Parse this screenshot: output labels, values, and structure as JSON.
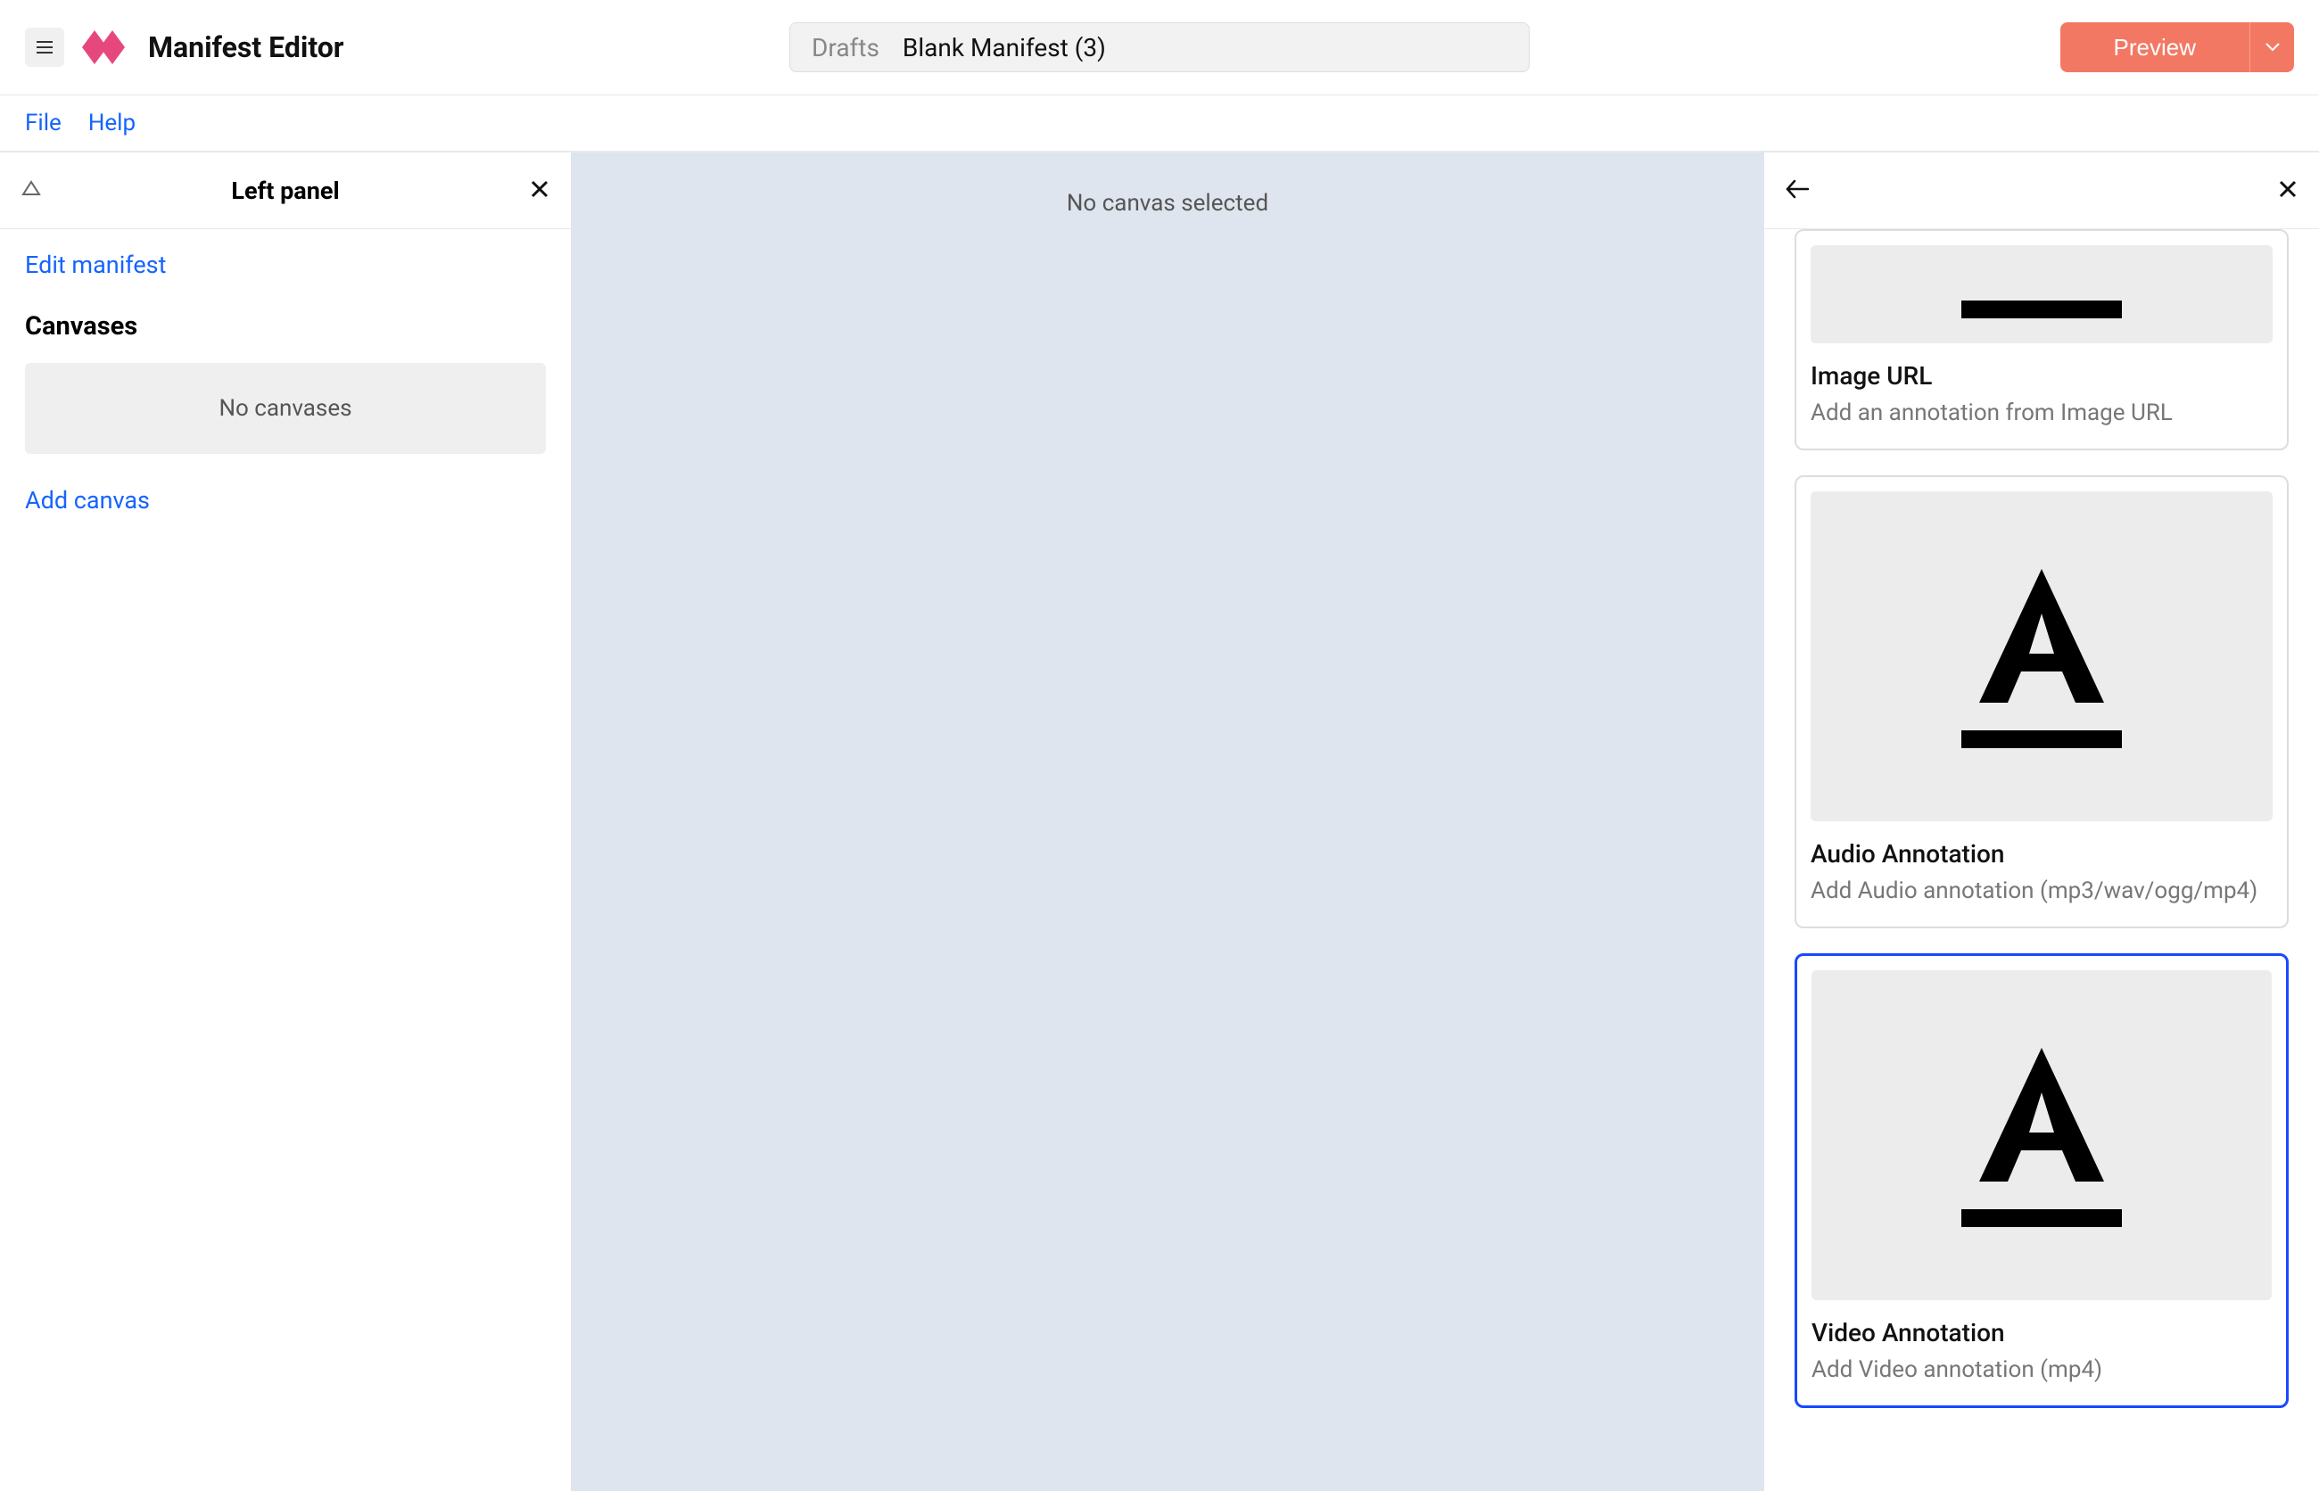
{
  "header": {
    "app_title": "Manifest Editor",
    "drafts_label": "Drafts",
    "manifest_title": "Blank Manifest (3)",
    "preview_label": "Preview"
  },
  "menubar": {
    "file_label": "File",
    "help_label": "Help"
  },
  "left_panel": {
    "title": "Left panel",
    "edit_manifest_link": "Edit manifest",
    "canvases_heading": "Canvases",
    "empty_text": "No canvases",
    "add_canvas_link": "Add canvas"
  },
  "center": {
    "no_canvas_text": "No canvas selected"
  },
  "right_panel": {
    "cards": [
      {
        "title": "Image URL",
        "desc": "Add an annotation from Image URL",
        "thumb_type": "partial",
        "selected": false
      },
      {
        "title": "Audio Annotation",
        "desc": "Add Audio annotation (mp3/wav/ogg/mp4)",
        "thumb_type": "full",
        "selected": false
      },
      {
        "title": "Video Annotation",
        "desc": "Add Video annotation (mp4)",
        "thumb_type": "full",
        "selected": true
      }
    ]
  }
}
